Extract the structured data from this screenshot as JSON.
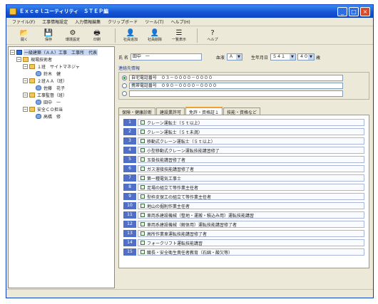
{
  "window": {
    "title": "Ｅｘｃｅｌユーティリティ　ＳＴＥＰ編",
    "minimize": "_",
    "maximize": "□",
    "close": "×"
  },
  "menu": [
    "ファイル(F)",
    "工事情報設定",
    "入力情報編集",
    "クリップボード",
    "ツール(T)",
    "ヘルプ(H)"
  ],
  "toolbar": [
    {
      "icon": "folder-open-icon",
      "glyph": "📂",
      "label": "開く"
    },
    {
      "icon": "save-icon",
      "glyph": "💾",
      "label": "保存"
    },
    {
      "icon": "settings-icon",
      "glyph": "⚙",
      "label": "環境設定"
    },
    {
      "icon": "print-icon",
      "glyph": "🖶",
      "label": "印刷"
    },
    {
      "icon": "person-add-icon",
      "glyph": "👤",
      "label": "社員追加"
    },
    {
      "icon": "person-remove-icon",
      "glyph": "👤",
      "label": "社員削除"
    },
    {
      "icon": "list-icon",
      "glyph": "☰",
      "label": "一覧表示"
    },
    {
      "icon": "help-icon",
      "glyph": "?",
      "label": "ヘルプ"
    }
  ],
  "tree": [
    {
      "indent": 0,
      "exp": "−",
      "icon": "pc",
      "label": "一級建築（ＡＡ）工事　工事所　代表",
      "selected": true
    },
    {
      "indent": 1,
      "exp": "−",
      "icon": "folder",
      "label": "現場技術者"
    },
    {
      "indent": 2,
      "exp": "−",
      "icon": "folder",
      "label": "１班　サイトマネジャ"
    },
    {
      "indent": 3,
      "exp": "",
      "icon": "person",
      "label": "鈴木　健"
    },
    {
      "indent": 2,
      "exp": "−",
      "icon": "folder",
      "label": "２班ＡＡ（班）"
    },
    {
      "indent": 3,
      "exp": "",
      "icon": "person",
      "label": "佐藤　花子"
    },
    {
      "indent": 2,
      "exp": "−",
      "icon": "folder",
      "label": "工事監督（班）"
    },
    {
      "indent": 3,
      "exp": "",
      "icon": "person",
      "label": "田中　一"
    },
    {
      "indent": 2,
      "exp": "−",
      "icon": "folder",
      "label": "安全ＣＯ担当"
    },
    {
      "indent": 3,
      "exp": "",
      "icon": "person",
      "label": "高橋　修"
    }
  ],
  "form": {
    "name_label": "氏 名",
    "name_value": "田中　一",
    "blood_label": "血液",
    "blood_value": "Ａ",
    "birth_label": "生年月日",
    "birth_value": "Ｓ４１",
    "birth_unit": "歳",
    "age_value": "４０"
  },
  "contact": {
    "title": "連絡先情報",
    "rows": [
      {
        "selected": true,
        "text": "自宅電話番号　０３－００００－００００"
      },
      {
        "selected": false,
        "text": "携帯電話番号　０９０－００００－００００"
      },
      {
        "selected": false,
        "text": ""
      }
    ]
  },
  "tabs": [
    {
      "label": "保険・健康診断",
      "active": false
    },
    {
      "label": "建設業許可",
      "active": false
    },
    {
      "label": "免許・資格証１",
      "active": true
    },
    {
      "label": "技能・資格など",
      "active": false
    }
  ],
  "qualifications": [
    {
      "num": "1",
      "text": "クレーン運転士（５ｔ以上）"
    },
    {
      "num": "2",
      "text": "クレーン運転士（５ｔ未満）"
    },
    {
      "num": "3",
      "text": "移動式クレーン運転士（５ｔ以上）"
    },
    {
      "num": "4",
      "text": "小型移動式クレーン運転技能講習修了"
    },
    {
      "num": "5",
      "text": "玉掛技能講習修了者"
    },
    {
      "num": "6",
      "text": "ガス溶接技能講習修了者"
    },
    {
      "num": "7",
      "text": "第一種電気工事士"
    },
    {
      "num": "8",
      "text": "足場の組立て等作業主任者"
    },
    {
      "num": "9",
      "text": "型枠支保工の組立て等作業主任者"
    },
    {
      "num": "10",
      "text": "地山の掘削作業主任者"
    },
    {
      "num": "11",
      "text": "車両系建設機械（整地・運搬・積込み用）運転技能講習"
    },
    {
      "num": "12",
      "text": "車両系建設機械（解体用）運転技能講習修了者"
    },
    {
      "num": "13",
      "text": "高所作業車運転技能講習修了者"
    },
    {
      "num": "14",
      "text": "フォークリフト運転技能講習"
    },
    {
      "num": "15",
      "text": "職長・安全衛生責任者教育（石綿・酸欠等）"
    }
  ]
}
